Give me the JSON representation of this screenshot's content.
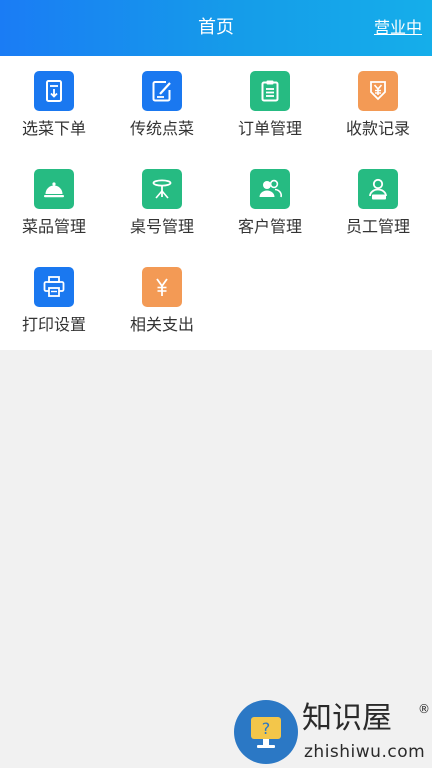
{
  "header": {
    "title": "首页",
    "status": "营业中"
  },
  "colors": {
    "blue": "#1a78f0",
    "green": "#26bb82",
    "orange": "#f39a55",
    "header_gradient": [
      "#1a7cf5",
      "#15aeea"
    ]
  },
  "menu": [
    {
      "label": "选菜下单",
      "icon": "order-form-icon",
      "color": "blue"
    },
    {
      "label": "传统点菜",
      "icon": "edit-note-icon",
      "color": "blue"
    },
    {
      "label": "订单管理",
      "icon": "clipboard-icon",
      "color": "green"
    },
    {
      "label": "收款记录",
      "icon": "yen-down-icon",
      "color": "orange"
    },
    {
      "label": "菜品管理",
      "icon": "food-cloche-icon",
      "color": "green"
    },
    {
      "label": "桌号管理",
      "icon": "table-icon",
      "color": "green"
    },
    {
      "label": "客户管理",
      "icon": "customers-icon",
      "color": "green"
    },
    {
      "label": "员工管理",
      "icon": "staff-icon",
      "color": "green"
    },
    {
      "label": "打印设置",
      "icon": "printer-icon",
      "color": "blue"
    },
    {
      "label": "相关支出",
      "icon": "yen-icon",
      "color": "orange"
    }
  ],
  "watermark": {
    "cn": "知识屋",
    "en": "zhishiwu.com",
    "mark": "®",
    "icon": "help-monitor-icon"
  }
}
